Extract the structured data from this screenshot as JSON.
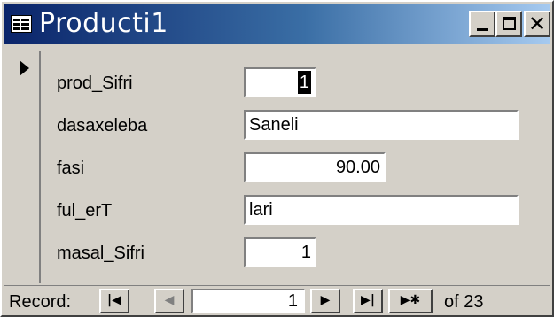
{
  "window": {
    "title": "Producti1",
    "icons": {
      "app": "table-form-icon",
      "minimize": "minimize-icon",
      "maximize": "maximize-icon",
      "close": "close-icon"
    }
  },
  "form": {
    "fields": [
      {
        "label": "prod_Sifri",
        "value": "1"
      },
      {
        "label": "dasaxeleba",
        "value": "Saneli"
      },
      {
        "label": "fasi",
        "value": "90.00"
      },
      {
        "label": "ful_erT",
        "value": "lari"
      },
      {
        "label": "masal_Sifri",
        "value": "1"
      }
    ]
  },
  "navigation": {
    "record_label": "Record:",
    "current_record": "1",
    "of_label": "of 23",
    "buttons": {
      "first": "|◀",
      "prev": "◀",
      "next": "▶",
      "last": "▶|",
      "new": "▶✱"
    }
  },
  "colors": {
    "titlebar_start": "#0a246a",
    "titlebar_end": "#a6caf0",
    "face": "#d4d0c8"
  }
}
